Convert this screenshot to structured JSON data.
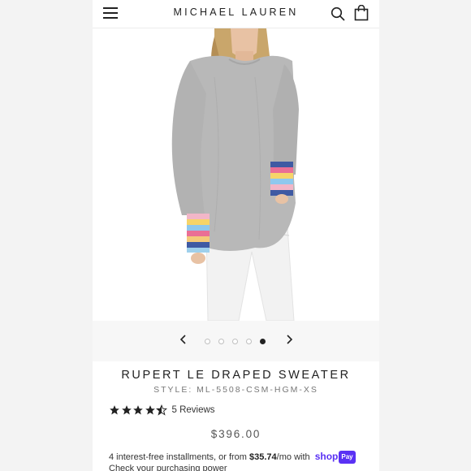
{
  "header": {
    "brand": "MICHAEL LAUREN",
    "menu_icon": "hamburger-menu-icon",
    "search_icon": "search-icon",
    "bag_icon": "shopping-bag-icon"
  },
  "gallery": {
    "image_description": "model wearing grey sweater with rainbow striped cuffs",
    "dots_total": 5,
    "active_index": 4
  },
  "product": {
    "title": "RUPERT LE DRAPED SWEATER",
    "style": "STYLE: ML-5508-CSM-HGM-XS",
    "rating": 4.5,
    "rating_max": 5,
    "reviews": "5 Reviews",
    "price": "$396.00"
  },
  "installments": {
    "prefix": "4 interest-free installments, or from ",
    "amount": "$35.74",
    "suffix": "/mo with ",
    "shop_label": "shop",
    "pay_label": "Pay",
    "check_text": "Check your purchasing power"
  },
  "colors": {
    "sweater": "#b4b4b4",
    "accent": "#5a31f4",
    "text": "#222222"
  }
}
